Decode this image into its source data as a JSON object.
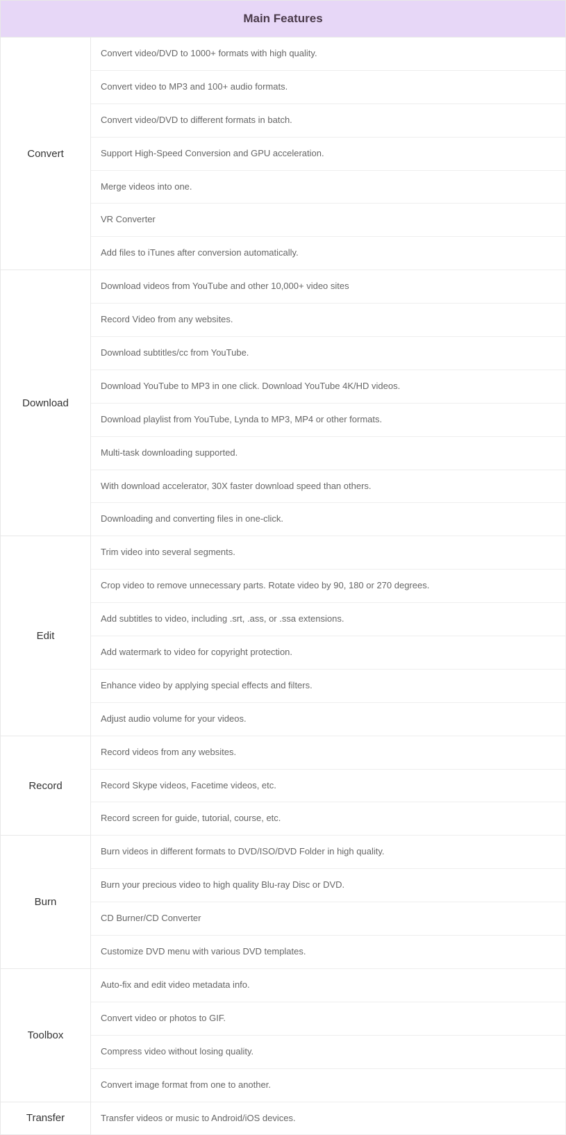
{
  "header": "Main Features",
  "sections": [
    {
      "name": "Convert",
      "items": [
        "Convert video/DVD to 1000+ formats with high quality.",
        "Convert video to MP3 and 100+ audio formats.",
        "Convert video/DVD to different formats in batch.",
        "Support High-Speed Conversion and GPU acceleration.",
        "Merge videos into one.",
        "VR Converter",
        "Add files to iTunes after conversion automatically."
      ]
    },
    {
      "name": "Download",
      "items": [
        "Download videos from YouTube and other 10,000+ video sites",
        "Record Video from any websites.",
        "Download subtitles/cc from YouTube.",
        "Download YouTube to MP3 in one click. Download YouTube 4K/HD videos.",
        "Download playlist from YouTube, Lynda to MP3, MP4 or other formats.",
        "Multi-task downloading supported.",
        "With download accelerator, 30X faster download speed than others.",
        "Downloading and converting files in one-click."
      ]
    },
    {
      "name": "Edit",
      "items": [
        "Trim video into several segments.",
        "Crop video to remove unnecessary parts. Rotate video by 90, 180 or 270 degrees.",
        "Add subtitles to video, including .srt, .ass, or .ssa extensions.",
        "Add watermark to video for copyright protection.",
        "Enhance video by applying special effects and filters.",
        "Adjust audio volume for your videos."
      ]
    },
    {
      "name": "Record",
      "items": [
        "Record videos from any websites.",
        "Record Skype videos, Facetime videos, etc.",
        "Record screen for guide, tutorial, course, etc."
      ]
    },
    {
      "name": "Burn",
      "items": [
        "Burn videos in different formats to DVD/ISO/DVD Folder in high quality.",
        "Burn your precious video to high quality Blu-ray Disc or DVD.",
        "CD Burner/CD Converter",
        "Customize DVD menu with various DVD templates."
      ]
    },
    {
      "name": "Toolbox",
      "items": [
        "Auto-fix and edit video metadata info.",
        "Convert video or photos to GIF.",
        "Compress video without losing quality.",
        "Convert image format from one to another."
      ]
    },
    {
      "name": "Transfer",
      "items": [
        "Transfer videos or music to Android/iOS devices."
      ]
    }
  ]
}
